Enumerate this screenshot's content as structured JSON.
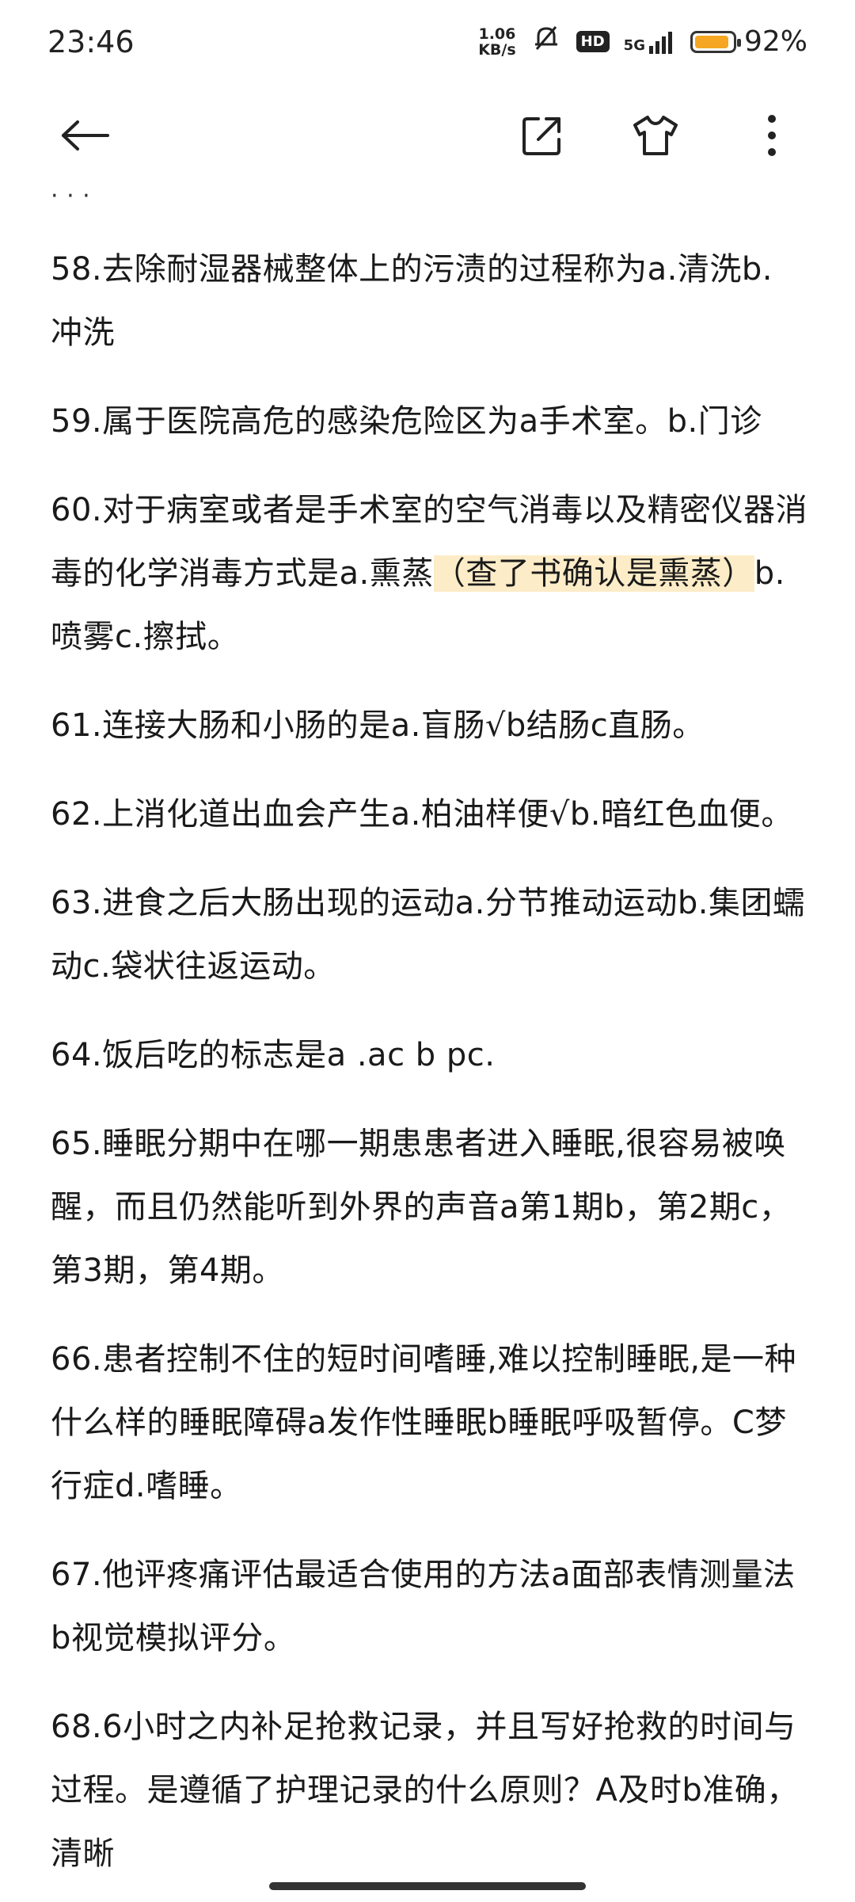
{
  "status_bar": {
    "time": "23:46",
    "net_speed_value": "1.06",
    "net_speed_unit": "KB/s",
    "hd_badge": "HD",
    "network": "5G",
    "battery_percent": "92%",
    "battery_level": 0.92
  },
  "toolbar": {
    "back_icon": "arrow-left-icon",
    "share_icon": "share-external-icon",
    "theme_icon": "tshirt-icon",
    "more_icon": "more-vertical-icon"
  },
  "content": {
    "top_fragment": "· · ·",
    "items": [
      {
        "text": "58.去除耐湿器械整体上的污渍的过程称为a.清洗b. 冲洗"
      },
      {
        "text": "59.属于医院高危的感染危险区为a手术室。b.门诊"
      },
      {
        "before": "60.对于病室或者是手术室的空气消毒以及精密仪器消毒的化学消毒方式是a.熏蒸",
        "highlight": "（查了书确认是熏蒸）",
        "after": "b.喷雾c.擦拭。"
      },
      {
        "text": "61.连接大肠和小肠的是a.盲肠√b结肠c直肠。"
      },
      {
        "text": "62.上消化道出血会产生a.柏油样便√b.暗红色血便。"
      },
      {
        "text": "63.进食之后大肠出现的运动a.分节推动运动b.集团蠕动c.袋状往返运动。"
      },
      {
        "text": "64.饭后吃的标志是a .ac  b  pc."
      },
      {
        "text": "65.睡眠分期中在哪一期患患者进入睡眠,很容易被唤醒，而且仍然能听到外界的声音a第1期b，第2期c，第3期，第4期。"
      },
      {
        "text": "66.患者控制不住的短时间嗜睡,难以控制睡眠,是一种什么样的睡眠障碍a发作性睡眠b睡眠呼吸暂停。C梦行症d.嗜睡。"
      },
      {
        "text": "67.他评疼痛评估最适合使用的方法a面部表情测量法b视觉模拟评分。"
      },
      {
        "text": "68.6小时之内补足抢救记录，并且写好抢救的时间与过程。是遵循了护理记录的什么原则？A及时b准确，清晰"
      }
    ]
  }
}
